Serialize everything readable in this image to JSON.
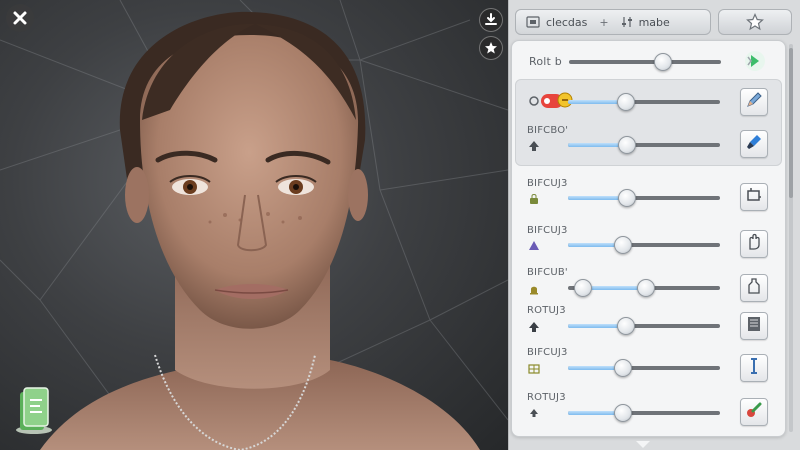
{
  "header": {
    "tab_main_label": "clecdas",
    "tab_separator": "+",
    "tab_secondary_label": "mabe",
    "star_icon": "star-icon"
  },
  "viewport": {
    "close_icon": "close-icon",
    "download_icon": "download-icon",
    "favorite_icon": "star-badge-icon",
    "logo_icon": "app-logo-icon"
  },
  "top_row": {
    "label": "Rolt b",
    "value": 0.62,
    "action_icon": "play-forward-icon"
  },
  "rows": [
    {
      "label": "",
      "icon": "color-swatch-icon",
      "value": 0.38,
      "button_icon": "pencil-icon"
    },
    {
      "label": "BIFCBO'",
      "icon": "up-arrow-icon",
      "value": 0.39,
      "button_icon": "brush-icon"
    },
    {
      "label": "BIFCUJ3",
      "icon": "lock-icon",
      "value": 0.39,
      "button_icon": "crop-icon"
    },
    {
      "label": "BIFCUJ3",
      "icon": "triangle-up-icon",
      "value": 0.36,
      "button_icon": "hand-icon"
    },
    {
      "label": "BIFCUB'",
      "icon": "bell-icon",
      "range": [
        0.1,
        0.51
      ],
      "button_icon": "bottle-icon"
    },
    {
      "label": "ROTUJ3",
      "icon": "dot-arrow-icon",
      "value": 0.38,
      "button_icon": "book-icon"
    },
    {
      "label": "BIFCUJ3",
      "icon": "grid-icon",
      "value": 0.36,
      "button_icon": "text-cursor-icon"
    },
    {
      "label": "ROTUJ3",
      "icon": "small-up-icon",
      "value": 0.36,
      "button_icon": "paint-tool-icon"
    }
  ]
}
